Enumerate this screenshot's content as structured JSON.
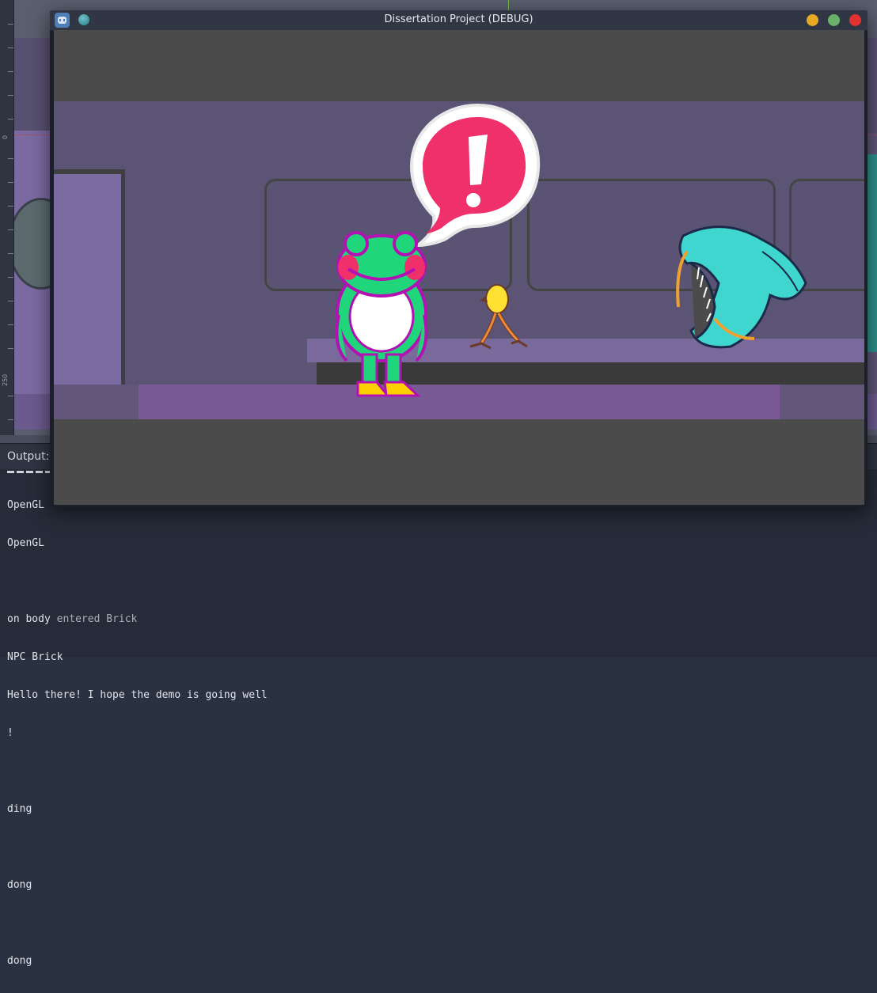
{
  "window": {
    "title": "Dissertation Project (DEBUG)",
    "icon": "godot-engine-icon"
  },
  "editor": {
    "ruler_labels": [
      "0",
      "250"
    ]
  },
  "output": {
    "title": "Output:",
    "lines": [
      {
        "text": "OpenGL",
        "style": ""
      },
      {
        "text": "OpenGL",
        "style": ""
      },
      {
        "text": "",
        "style": ""
      },
      {
        "text": "on body ",
        "extra": "entered Brick",
        "style": ""
      },
      {
        "text": "NPC Brick",
        "style": ""
      },
      {
        "text": "Hello there! I hope the demo is going well",
        "style": ""
      },
      {
        "text": "!",
        "style": ""
      },
      {
        "text": "",
        "style": ""
      },
      {
        "text": "ding",
        "style": ""
      },
      {
        "text": "",
        "style": ""
      },
      {
        "text": "dong",
        "style": ""
      },
      {
        "text": "",
        "style": ""
      },
      {
        "text": "dong",
        "style": ""
      }
    ]
  },
  "colors": {
    "accent_close": "#e0332f",
    "accent_min": "#e9a823",
    "accent_max": "#6ab06a",
    "frog_green": "#1fd67a",
    "frog_outline": "#b311b3",
    "alert_pink": "#f0306a",
    "monster_cyan": "#3fd6d0"
  }
}
